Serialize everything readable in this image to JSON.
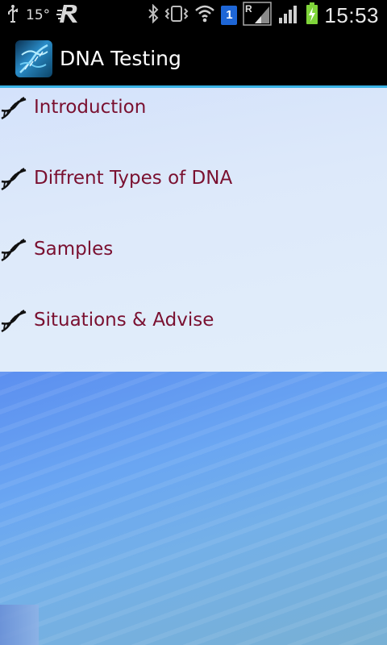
{
  "status_bar": {
    "temperature": "15°",
    "sim_number": "1",
    "time": "15:53"
  },
  "app": {
    "title": "DNA Testing",
    "icon": "dna-app-icon"
  },
  "menu": {
    "items": [
      {
        "label": "Introduction",
        "icon": "dna-icon"
      },
      {
        "label": "Diffrent Types of DNA",
        "icon": "dna-icon"
      },
      {
        "label": "Samples",
        "icon": "dna-icon"
      },
      {
        "label": "Situations & Advise",
        "icon": "dna-icon"
      }
    ]
  },
  "colors": {
    "item_text": "#7a1030",
    "title_divider": "#39b3e6",
    "background": "#6a9ff0"
  }
}
